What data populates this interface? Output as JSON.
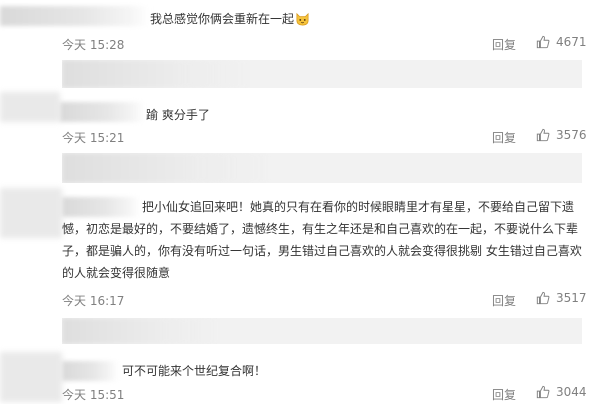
{
  "comments": [
    {
      "text": "我总感觉你俩会重新在一起",
      "time": "今天 15:28",
      "reply_label": "回复",
      "likes": "4671",
      "emoji": "cat-face-icon"
    },
    {
      "text": "爽分手了",
      "text_prefix": "踰",
      "time": "今天 15:21",
      "reply_label": "回复",
      "likes": "3576"
    },
    {
      "text": "把小仙女追回来吧！她真的只有在看你的时候眼睛里才有星星，不要给自己留下遗憾，初恋是最好的，不要结婚了，遗憾终生，有生之年还是和自己喜欢的在一起，不要说什么下辈子，都是骗人的，你有没有听过一句话，男生错过自己喜欢的人就会变得很挑剔 女生错过自己喜欢的人就会变得很随意",
      "time": "今天 16:17",
      "reply_label": "回复",
      "likes": "3517"
    },
    {
      "text": "可不可能来个世纪复合啊！",
      "time": "今天 15:51",
      "reply_label": "回复",
      "likes": "3044"
    }
  ],
  "colors": {
    "meta_gray": "#808080",
    "text": "#333333",
    "sub_bg": "#f2f2f2"
  }
}
